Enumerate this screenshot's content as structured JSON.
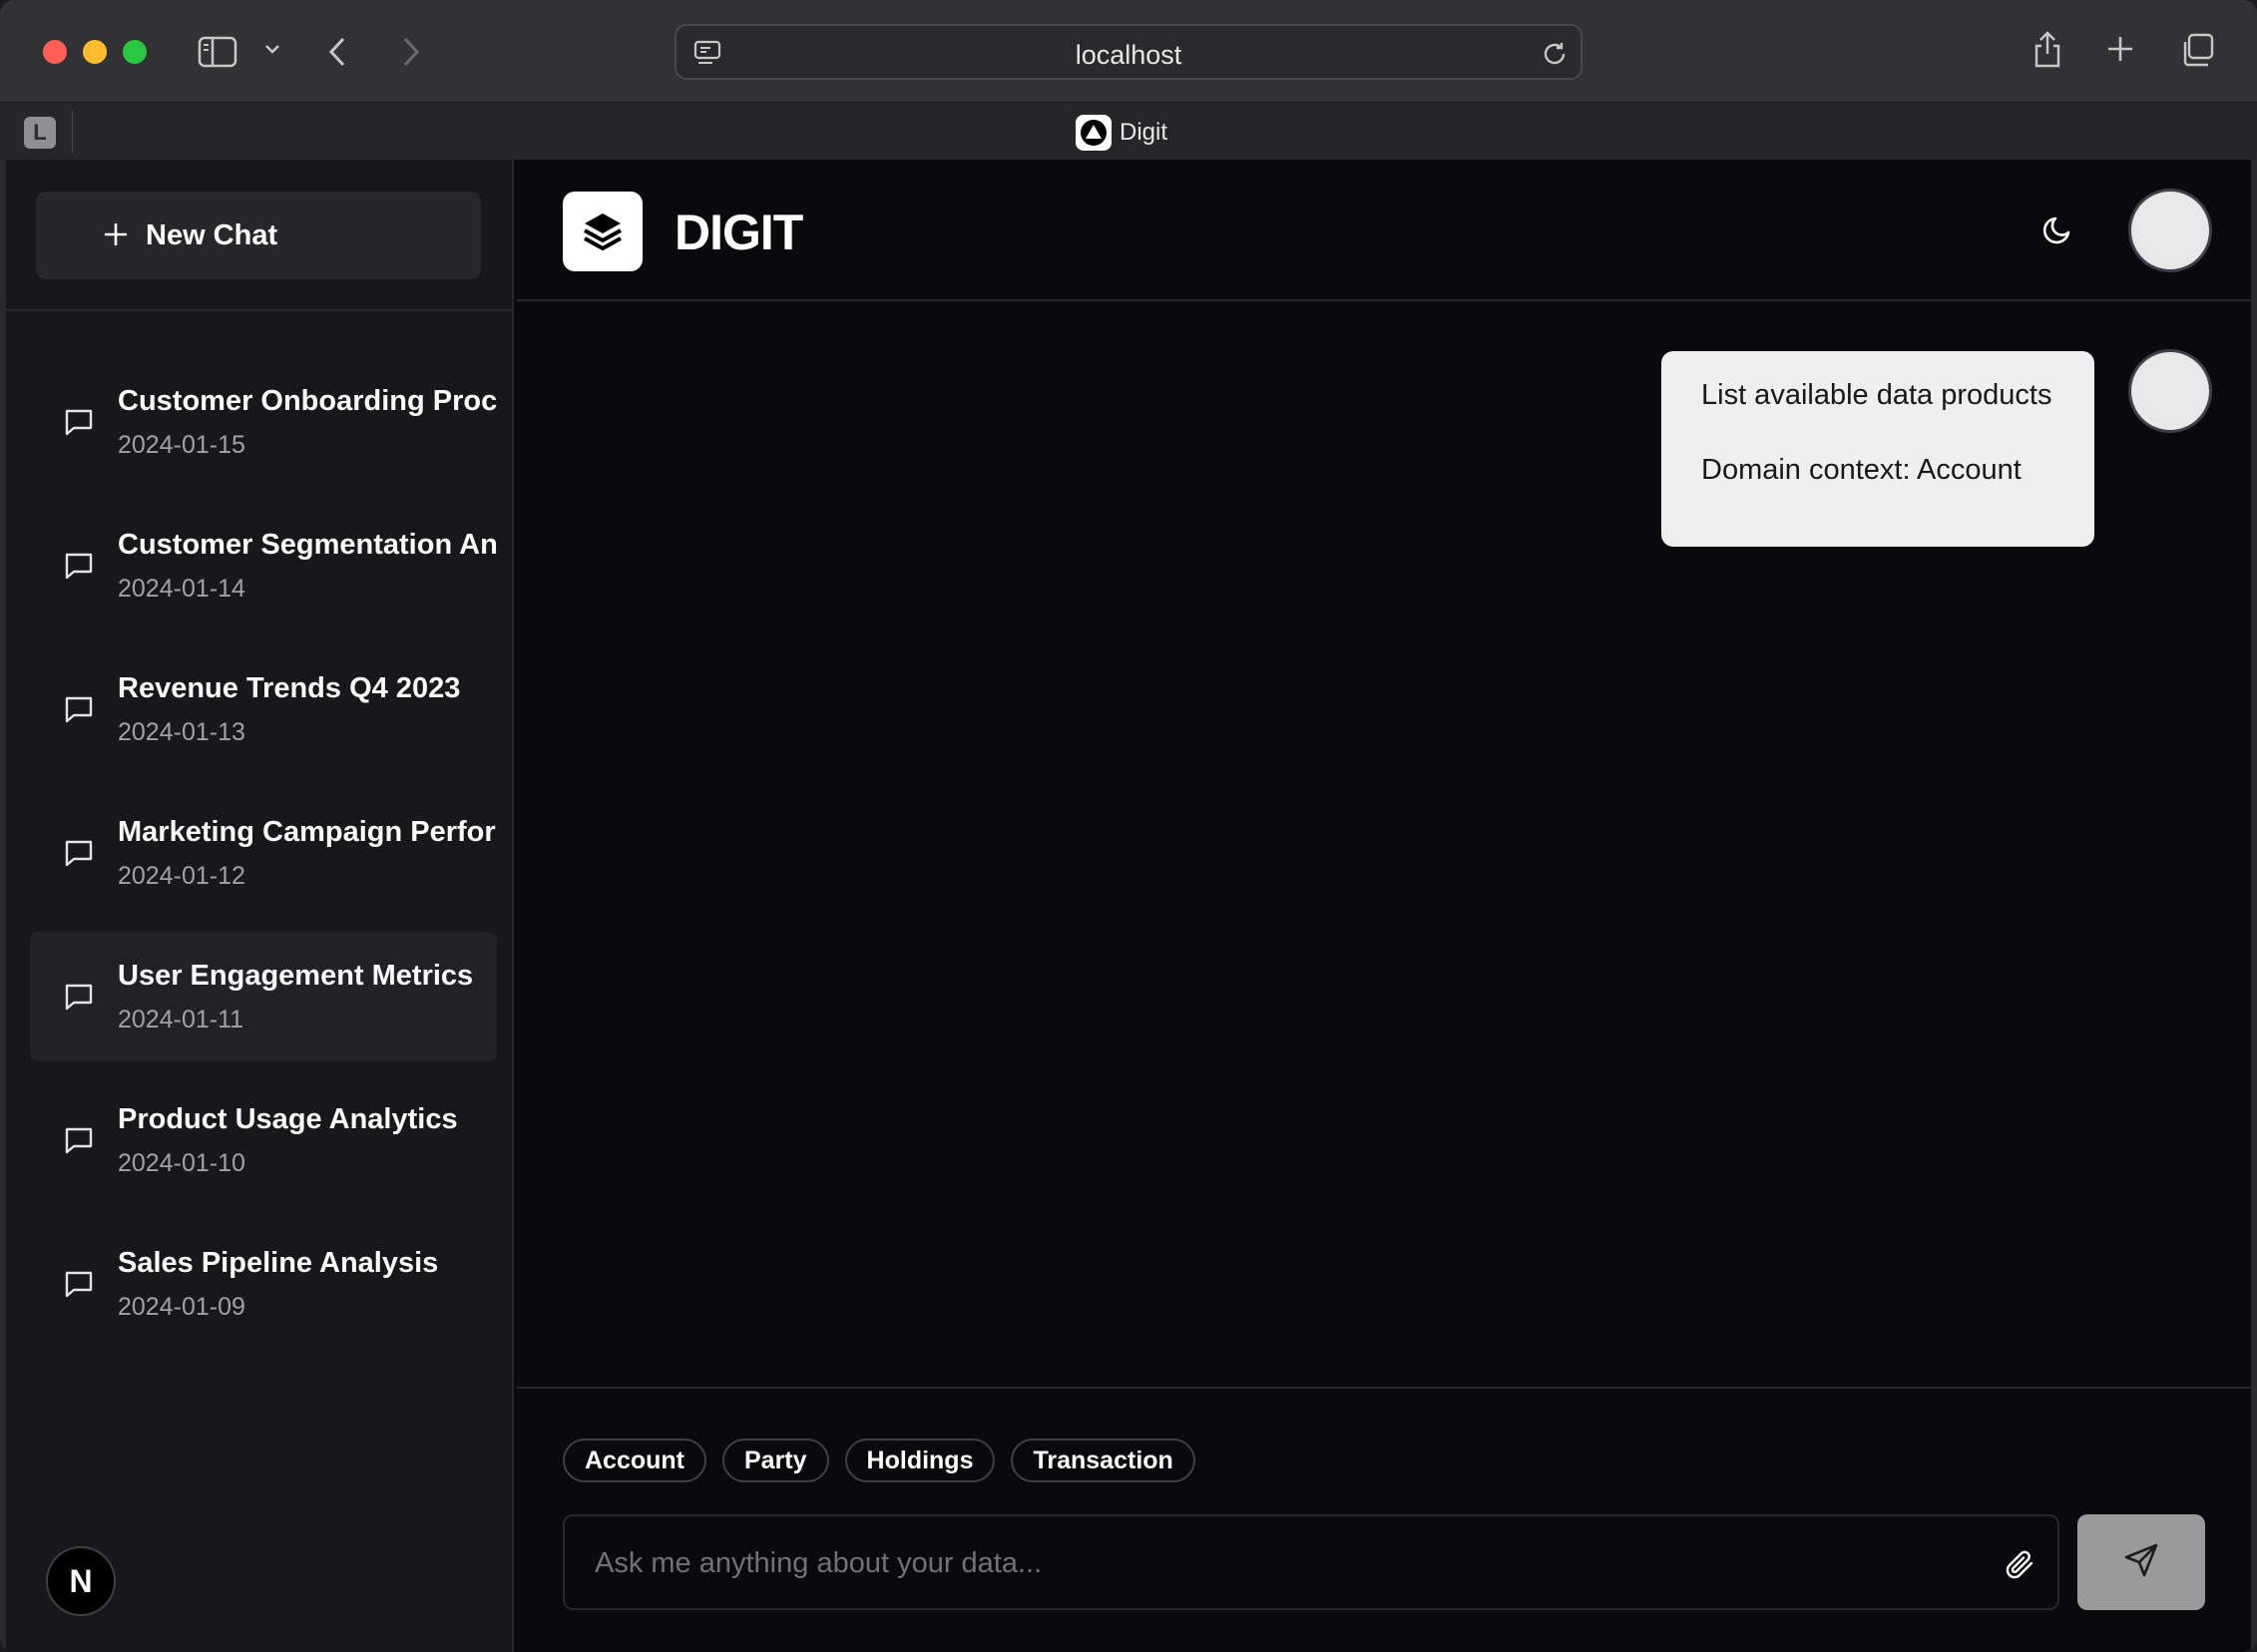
{
  "browser": {
    "url": "localhost",
    "tab_letter": "L",
    "tab_title": "Digit"
  },
  "sidebar": {
    "new_chat_label": "New Chat",
    "conversations": [
      {
        "title": "Customer Onboarding Process",
        "date": "2024-01-15"
      },
      {
        "title": "Customer Segmentation Analysis",
        "date": "2024-01-14"
      },
      {
        "title": "Revenue Trends Q4 2023",
        "date": "2024-01-13"
      },
      {
        "title": "Marketing Campaign Performance",
        "date": "2024-01-12"
      },
      {
        "title": "User Engagement Metrics",
        "date": "2024-01-11"
      },
      {
        "title": "Product Usage Analytics",
        "date": "2024-01-10"
      },
      {
        "title": "Sales Pipeline Analysis",
        "date": "2024-01-09"
      }
    ],
    "active_index": 4,
    "badge": "N"
  },
  "header": {
    "brand": "DIGIT"
  },
  "chat": {
    "user_message_line1": "List available data products",
    "user_message_line2": "Domain context: Account"
  },
  "composer": {
    "chips": [
      "Account",
      "Party",
      "Holdings",
      "Transaction"
    ],
    "placeholder": "Ask me anything about your data..."
  },
  "colors": {
    "background": "#0a0a0c",
    "sidebar": "#18181b",
    "bubble": "#efefef",
    "send_button": "#9a9a9a"
  }
}
